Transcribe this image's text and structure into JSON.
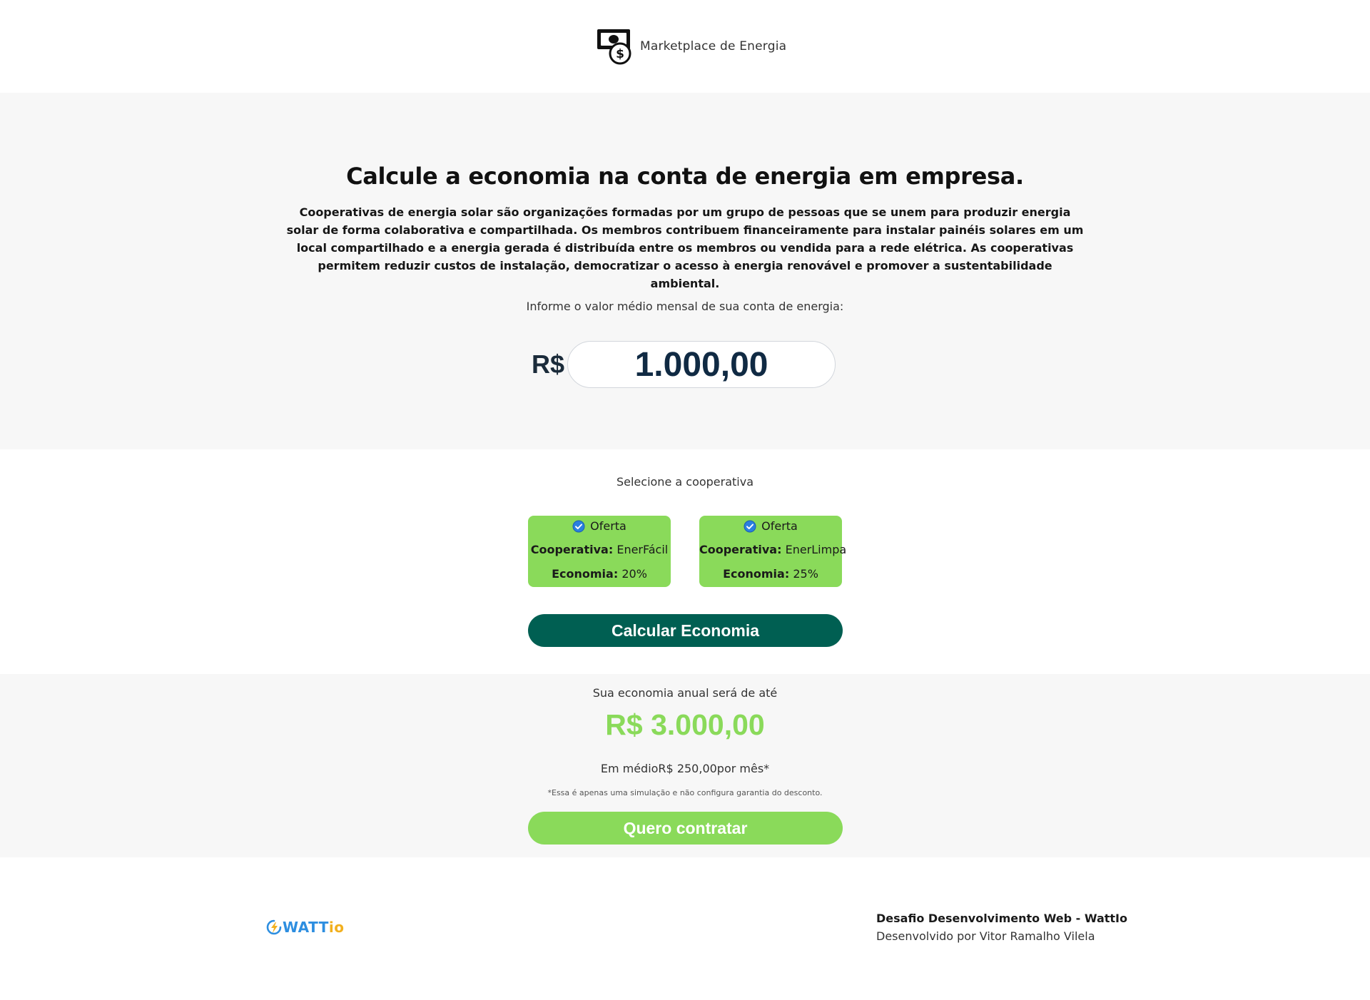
{
  "header": {
    "brand_icon": "money-bill-dollar-icon",
    "brand_name": "Marketplace de Energia"
  },
  "hero": {
    "title": "Calcule a economia na conta de energia em empresa.",
    "description": "Cooperativas de energia solar são organizações formadas por um grupo de pessoas que se unem para produzir energia solar de forma colaborativa e compartilhada. Os membros contribuem financeiramente para instalar painéis solares em um local compartilhado e a energia gerada é distribuída entre os membros ou vendida para a rede elétrica. As cooperativas permitem reduzir custos de instalação, democratizar o acesso à energia renovável e promover a sustentabilidade ambiental.",
    "bill_label": "Informe o valor médio mensal de sua conta de energia:",
    "currency_prefix": "R$",
    "bill_value": "1.000,00"
  },
  "selection": {
    "label": "Selecione a cooperativa",
    "cards": [
      {
        "badge": "Oferta",
        "badge_icon": "check-circle-icon",
        "coop_key": "Cooperativa:",
        "coop_value": "EnerFácil",
        "saving_key": "Economia:",
        "saving_value": "20%"
      },
      {
        "badge": "Oferta",
        "badge_icon": "check-circle-icon",
        "coop_key": "Cooperativa:",
        "coop_value": "EnerLimpa",
        "saving_key": "Economia:",
        "saving_value": "25%"
      }
    ],
    "calc_button": "Calcular Economia"
  },
  "result": {
    "label": "Sua economia anual será de até",
    "value": "R$ 3.000,00",
    "monthly": "Em médioR$ 250,00por mês*",
    "disclaimer": "*Essa é apenas uma simulação e não configura garantia do desconto.",
    "contract_button": "Quero contratar"
  },
  "footer": {
    "logo_icon": "lightning-bolt-icon",
    "logo_watt": "WATT",
    "logo_io": "io",
    "title": "Desafio Desenvolvimento Web - WattIo",
    "developer": "Desenvolvido por Vitor Ramalho Vilela"
  },
  "colors": {
    "accent_green": "#8ada5a",
    "dark_green": "#005f52",
    "section_background": "#f7f7f7",
    "logo_blue": "#2d8ee0",
    "logo_yellow": "#f2b01e"
  }
}
